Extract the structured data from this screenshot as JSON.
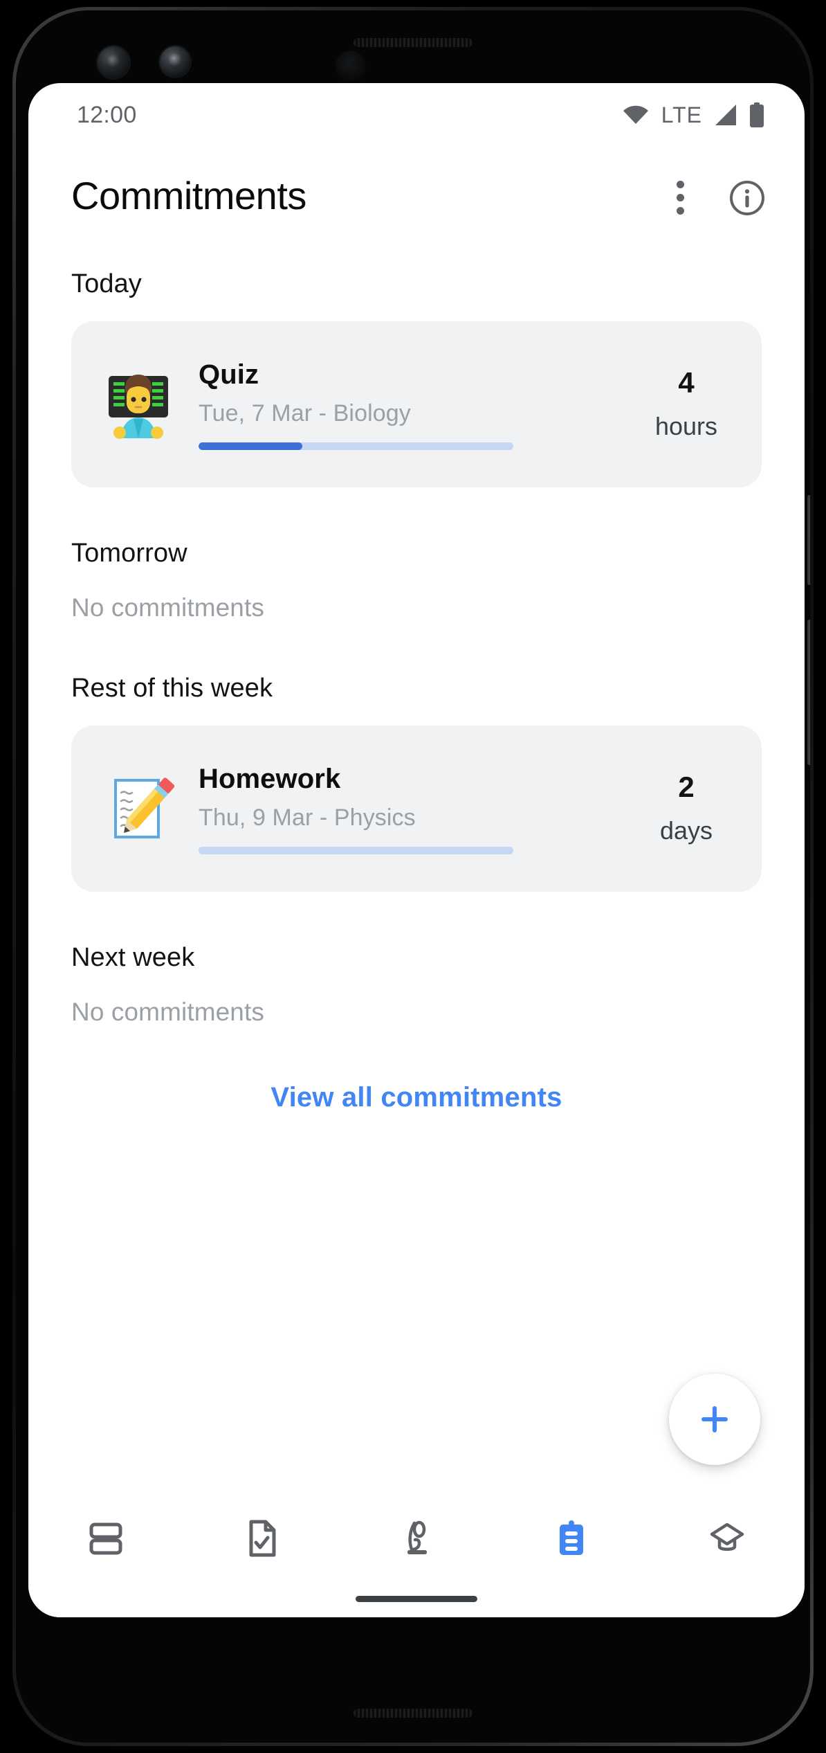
{
  "status_bar": {
    "time": "12:00",
    "wifi_icon": "wifi-icon",
    "network_label": "LTE",
    "signal_icon": "cell-signal-icon",
    "battery_icon": "battery-full-icon"
  },
  "app_bar": {
    "title": "Commitments",
    "overflow_icon": "more-vert-icon",
    "info_icon": "info-circle-icon"
  },
  "colors": {
    "accent": "#4285f4",
    "progress_fill": "#3c72d7",
    "progress_track": "#c6d7f5",
    "card_bg": "#f1f2f3",
    "muted_text": "#9aa0a6",
    "nav_inactive": "#5f6368",
    "nav_active": "#4285f4"
  },
  "sections": [
    {
      "heading": "Today",
      "empty_text": null,
      "items": [
        {
          "emoji_name": "technologist-emoji",
          "title": "Quiz",
          "subtitle": "Tue, 7 Mar - Biology",
          "progress_percent": 33,
          "count": "4",
          "unit": "hours"
        }
      ]
    },
    {
      "heading": "Tomorrow",
      "empty_text": "No commitments",
      "items": []
    },
    {
      "heading": "Rest of this week",
      "empty_text": null,
      "items": [
        {
          "emoji_name": "memo-emoji",
          "title": "Homework",
          "subtitle": "Thu, 9 Mar - Physics",
          "progress_percent": 0,
          "count": "2",
          "unit": "days"
        }
      ]
    },
    {
      "heading": "Next week",
      "empty_text": "No commitments",
      "items": []
    }
  ],
  "view_all": {
    "label": "View all commitments"
  },
  "fab": {
    "icon": "plus-icon",
    "label": "Add commitment"
  },
  "bottom_nav": {
    "items": [
      {
        "icon": "dashboard-icon",
        "active": false
      },
      {
        "icon": "document-check-icon",
        "active": false
      },
      {
        "icon": "trophy-icon",
        "active": false
      },
      {
        "icon": "clipboard-icon",
        "active": true
      },
      {
        "icon": "graduation-cap-icon",
        "active": false
      }
    ]
  }
}
